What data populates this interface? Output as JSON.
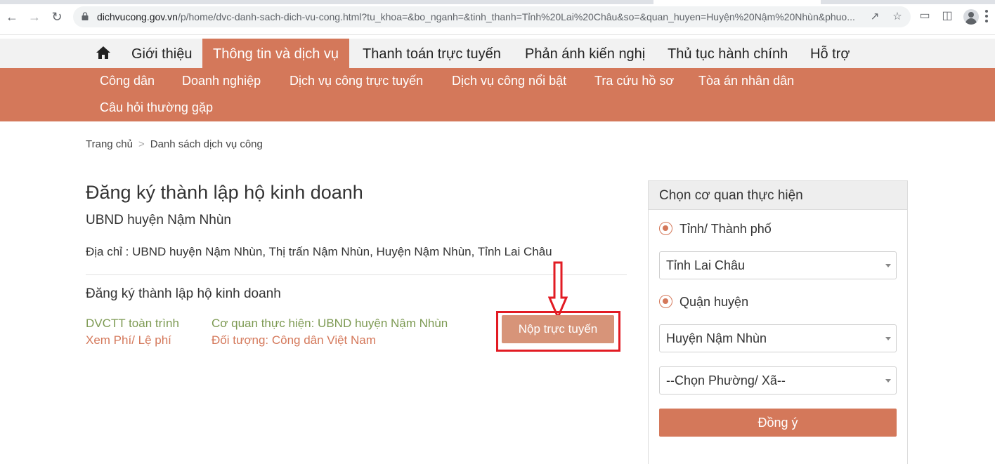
{
  "browser": {
    "url_host": "dichvucong.gov.vn",
    "url_rest": "/p/home/dvc-danh-sach-dich-vu-cong.html?tu_khoa=&bo_nganh=&tinh_thanh=Tỉnh%20Lai%20Châu&so=&quan_huyen=Huyện%20Nậm%20Nhùn&phuo...",
    "icons": [
      "back-arrow-icon",
      "forward-arrow-icon",
      "reload-icon",
      "lock-icon",
      "share-icon",
      "star-icon",
      "extensions-icon",
      "side-panel-icon",
      "profile-icon",
      "menu-icon"
    ]
  },
  "topnav": {
    "items": [
      "Giới thiệu",
      "Thông tin và dịch vụ",
      "Thanh toán trực tuyến",
      "Phản ánh kiến nghị",
      "Thủ tục hành chính",
      "Hỗ trợ"
    ],
    "active_index": 1
  },
  "subnav": {
    "items": [
      "Công dân",
      "Doanh nghiệp",
      "Dịch vụ công trực tuyến",
      "Dịch vụ công nổi bật",
      "Tra cứu hồ sơ",
      "Tòa án nhân dân",
      "Câu hỏi thường gặp"
    ]
  },
  "breadcrumb": {
    "home": "Trang chủ",
    "separator": ">",
    "current": "Danh sách dịch vụ công"
  },
  "main": {
    "title": "Đăng ký thành lập hộ kinh doanh",
    "agency": "UBND huyện Nậm Nhùn",
    "address": "Địa chỉ : UBND huyện Nậm Nhùn, Thị trấn Nậm Nhùn, Huyện Nậm Nhùn, Tỉnh Lai Châu",
    "procedure": {
      "title": "Đăng ký thành lập hộ kinh doanh",
      "level": "DVCTT toàn trình",
      "fees_link": "Xem Phí/ Lệ phí",
      "executing_agency": "Cơ quan thực hiện: UBND huyện Nậm Nhùn",
      "target": "Đối tượng: Công dân Việt Nam",
      "submit_label": "Nộp trực tuyến"
    }
  },
  "sidebar": {
    "heading": "Chọn cơ quan thực hiện",
    "radio_province": "Tỉnh/ Thành phố",
    "province_value": "Tỉnh Lai Châu",
    "radio_district": "Quận huyện",
    "district_value": "Huyện Nậm Nhùn",
    "ward_value": "--Chọn Phường/ Xã--",
    "agree_label": "Đồng ý"
  },
  "colors": {
    "accent": "#d4785a",
    "highlight_border": "#e21b23",
    "green_text": "#7d9a53"
  }
}
